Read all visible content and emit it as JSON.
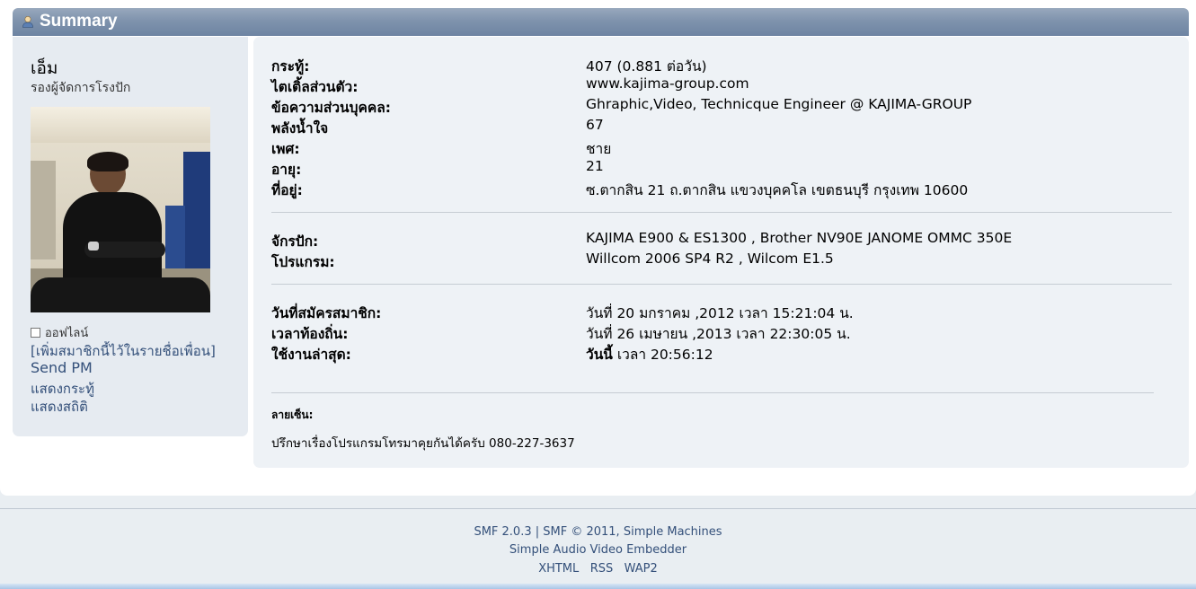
{
  "header": {
    "title": "Summary",
    "icon": "user-icon"
  },
  "profile": {
    "name": "เอ็ม",
    "position": "รองผู้จัดการโรงปัก",
    "status": "ออฟไลน์",
    "links": {
      "add_buddy": "[เพิ่มสมาชิกนี้ไว้ในรายชื่อเพื่อน]",
      "send_pm": "Send PM",
      "show_posts": "แสดงกระทู้",
      "show_stats": "แสดงสถิติ"
    }
  },
  "details": {
    "group1": [
      {
        "label": "กระทู้:",
        "value": "407 (0.881 ต่อวัน)"
      },
      {
        "label": "ไตเติ้ลส่วนตัว:",
        "value": "www.kajima-group.com"
      },
      {
        "label": "ข้อความส่วนบุคคล:",
        "value": "Ghraphic,Video, Technicque Engineer @ KAJIMA-GROUP"
      },
      {
        "label": "พลังน้ำใจ",
        "value": "67"
      },
      {
        "label": "เพศ:",
        "value": "ชาย"
      },
      {
        "label": "อายุ:",
        "value": "21"
      },
      {
        "label": "ที่อยู่:",
        "value": "ซ.ตากสิน 21 ถ.ตากสิน แขวงบุคคโล เขตธนบุรี กรุงเทพ 10600"
      }
    ],
    "group2": [
      {
        "label": "จักรปัก:",
        "value": "KAJIMA E900 & ES1300 , Brother NV90E JANOME OMMC 350E"
      },
      {
        "label": "โปรแกรม:",
        "value": "Willcom 2006 SP4 R2 , Wilcom E1.5"
      }
    ],
    "group3": [
      {
        "label": "วันที่สมัครสมาชิก:",
        "value": "วันที่ 20 มกราคม ,2012 เวลา 15:21:04 น."
      },
      {
        "label": "เวลาท้องถิ่น:",
        "value": "วันที่ 26 เมษายน ,2013 เวลา 22:30:05 น."
      },
      {
        "label": "ใช้งานล่าสุด:",
        "value_bold": "วันนี้",
        "value": " เวลา 20:56:12"
      }
    ],
    "signature_label": "ลายเซ็น:",
    "signature": "ปรึกษาเรื่องโปรแกรมโทรมาคุยกันได้ครับ 080-227-3637"
  },
  "footer": {
    "smf_version": "SMF 2.0.3",
    "separator": "|",
    "copyright": "SMF © 2011, Simple Machines",
    "embedder": "Simple Audio Video Embedder",
    "xhtml": "XHTML",
    "rss": "RSS",
    "wap2": "WAP2"
  },
  "colors": {
    "header_bar": "#7f93ad",
    "link": "#34507a",
    "panel": "#e6ebf1"
  }
}
